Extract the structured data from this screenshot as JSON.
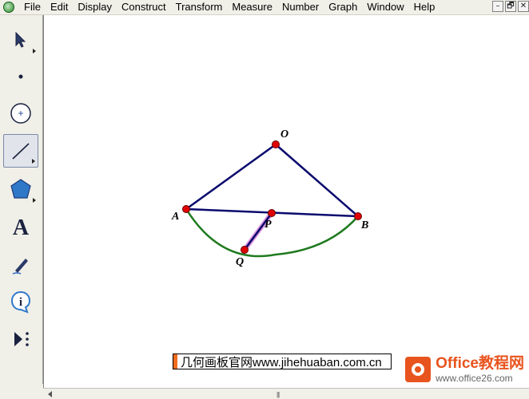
{
  "menubar": {
    "items": [
      "File",
      "Edit",
      "Display",
      "Construct",
      "Transform",
      "Measure",
      "Number",
      "Graph",
      "Window",
      "Help"
    ],
    "window_controls": [
      "–",
      "🗗",
      "✕"
    ]
  },
  "toolbox": {
    "tools": [
      {
        "name": "arrow-tool",
        "icon": "arrow-icon"
      },
      {
        "name": "point-tool",
        "icon": "point-icon"
      },
      {
        "name": "compass-tool",
        "icon": "circle-icon"
      },
      {
        "name": "straightedge-tool",
        "icon": "segment-icon",
        "selected": true
      },
      {
        "name": "polygon-tool",
        "icon": "polygon-icon"
      },
      {
        "name": "text-tool",
        "icon": "text-icon",
        "label": "A"
      },
      {
        "name": "marker-tool",
        "icon": "pen-icon"
      },
      {
        "name": "information-tool",
        "icon": "info-icon",
        "label": "i"
      },
      {
        "name": "custom-tool",
        "icon": "play-icon"
      }
    ]
  },
  "figure": {
    "points": {
      "O": {
        "label": "O"
      },
      "A": {
        "label": "A"
      },
      "B": {
        "label": "B"
      },
      "P": {
        "label": "P"
      },
      "Q": {
        "label": "Q"
      }
    },
    "colors": {
      "segment": "#0a0a6e",
      "arc": "#1f7a1f",
      "point": "#e00000",
      "highlight": "#cc66cc"
    }
  },
  "caption": {
    "text": "几何画板官网www.jihehuaban.com.cn"
  },
  "logo": {
    "title": "Office教程网",
    "url": "www.office26.com"
  }
}
